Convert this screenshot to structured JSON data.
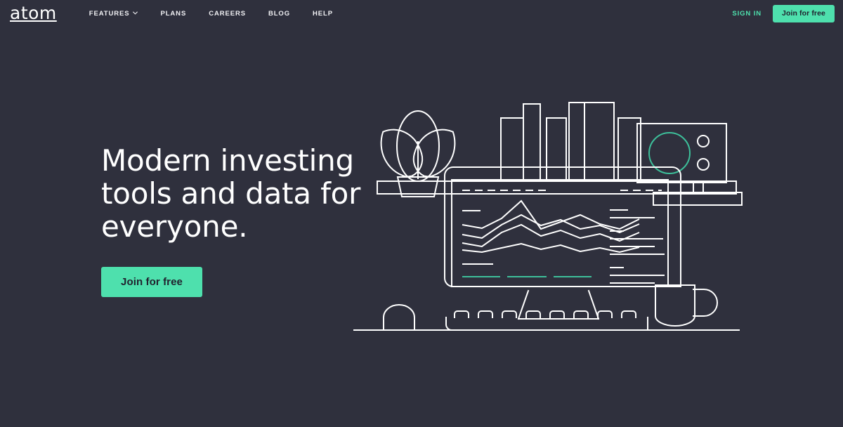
{
  "brand": {
    "logo_text": "atom"
  },
  "nav": {
    "items": [
      {
        "label": "FEATURES",
        "has_dropdown": true,
        "icon": "chevron-down-icon"
      },
      {
        "label": "PLANS",
        "has_dropdown": false
      },
      {
        "label": "CAREERS",
        "has_dropdown": false
      },
      {
        "label": "BLOG",
        "has_dropdown": false
      },
      {
        "label": "HELP",
        "has_dropdown": false
      }
    ],
    "sign_in_label": "SIGN IN",
    "cta_label": "Join for free"
  },
  "hero": {
    "headline_line1": "Modern investing",
    "headline_line2": "tools and data for",
    "headline_line3": "everyone.",
    "cta_label": "Join for free"
  },
  "colors": {
    "background": "#2f303d",
    "accent": "#4ee0ad",
    "accent_dark": "#3dbf9a",
    "text": "#ffffff",
    "cta_text": "#21222e",
    "line_art": "#ffffff"
  },
  "illustration": {
    "name": "desk-workspace-illustration",
    "elements": [
      "potted-plant",
      "books",
      "shelf",
      "speaker-device",
      "monitor",
      "monitor-stand",
      "keyboard",
      "mouse",
      "coffee-mug",
      "desk-surface"
    ],
    "screen_chart": {
      "type": "line",
      "series_count": 4,
      "accent_underline_count": 3
    }
  }
}
